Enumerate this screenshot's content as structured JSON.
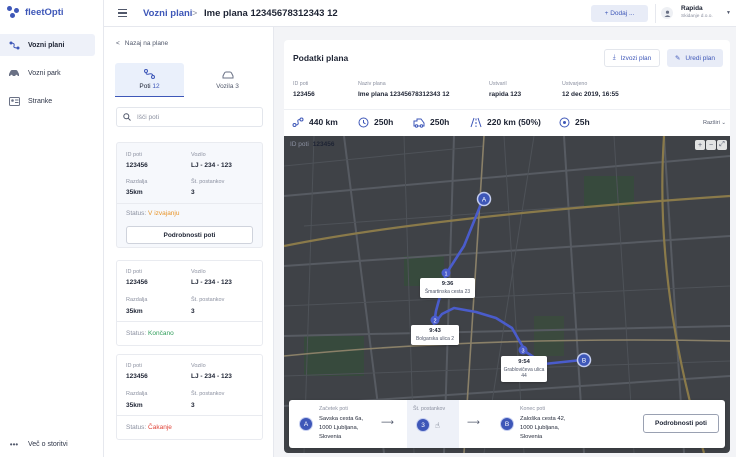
{
  "app": {
    "name": "fleetOpti"
  },
  "nav": {
    "items": [
      {
        "label": "Vozni plani",
        "icon": "route-icon",
        "active": true
      },
      {
        "label": "Vozni park",
        "icon": "car-icon",
        "active": false
      },
      {
        "label": "Stranke",
        "icon": "contacts-icon",
        "active": false
      }
    ],
    "more": "Več o storitvi"
  },
  "header": {
    "breadcrumb": "Vozni plani",
    "title": "Ime plana 12345678312343 12",
    "add_button": "+ Dodaj ...",
    "user": {
      "name": "Rapida",
      "sub": "Skidanje d.o.o."
    }
  },
  "routes_panel": {
    "back": "Nazaj na plane",
    "tabs": [
      {
        "label": "Poti",
        "count": "12",
        "icon": "route-icon",
        "active": true
      },
      {
        "label": "Vozila",
        "count": "3",
        "icon": "car-icon",
        "active": false
      }
    ],
    "search_placeholder": "Išči poti",
    "labels": {
      "id": "ID poti",
      "vehicle": "Vozilo",
      "distance": "Razdalja",
      "stops": "Št. postankov",
      "status": "Status:",
      "details": "Podrobnosti poti"
    },
    "routes": [
      {
        "id": "123456",
        "vehicle": "LJ - 234 - 123",
        "distance": "35km",
        "stops": "3",
        "status": "V izvajanju",
        "status_color": "#e8952a",
        "selected": true
      },
      {
        "id": "123456",
        "vehicle": "LJ - 234 - 123",
        "distance": "35km",
        "stops": "3",
        "status": "Končano",
        "status_color": "#2f9e5a",
        "selected": false
      },
      {
        "id": "123456",
        "vehicle": "LJ - 234 - 123",
        "distance": "35km",
        "stops": "3",
        "status": "Čakanje",
        "status_color": "#e0453a",
        "selected": false
      }
    ]
  },
  "plan": {
    "section_title": "Podatki plana",
    "export_button": "Izvozi plan",
    "edit_button": "Uredi plan",
    "info": [
      {
        "label": "ID poti",
        "value": "123456"
      },
      {
        "label": "Naziv plana",
        "value": "Ime plana 12345678312343 12"
      },
      {
        "label": "Ustvaril",
        "value": "rapida 123"
      },
      {
        "label": "Ustvarjeno",
        "value": "12 dec 2019, 16:55"
      }
    ],
    "stats": [
      {
        "icon": "route-icon",
        "value": "440 km"
      },
      {
        "icon": "clock-icon",
        "value": "250h"
      },
      {
        "icon": "truck-icon",
        "value": "250h"
      },
      {
        "icon": "road-icon",
        "value": "220 km (50%)"
      },
      {
        "icon": "pin-icon",
        "value": "25h"
      }
    ],
    "expand": "Razširi"
  },
  "map": {
    "route_id_label": "ID poti",
    "route_id": "123456",
    "markers": {
      "start": "A",
      "end": "B"
    },
    "stops": [
      {
        "n": "1",
        "time": "9:36",
        "address": "Šmartinska cesta 23"
      },
      {
        "n": "2",
        "time": "9:43",
        "address": "Bolgarska ulica 2"
      },
      {
        "n": "3",
        "time": "9:54",
        "address": "Grablovičeva ulica 44"
      }
    ],
    "controls": {
      "zoom_in": "+",
      "zoom_out": "−",
      "fullscreen": "⤢"
    }
  },
  "stop_bar": {
    "start_label": "Začetek poti",
    "start_marker": "A",
    "start_lines": [
      "Savska cesta 6a,",
      "1000 Ljubljana,",
      "Slovenia"
    ],
    "stops_label": "Št. postankov",
    "stops_count": "3",
    "end_label": "Konec poti",
    "end_marker": "B",
    "end_lines": [
      "Zaloška cesta 42,",
      "1000 Ljubljana,",
      "Slovenia"
    ],
    "details_button": "Podrobnosti poti"
  }
}
